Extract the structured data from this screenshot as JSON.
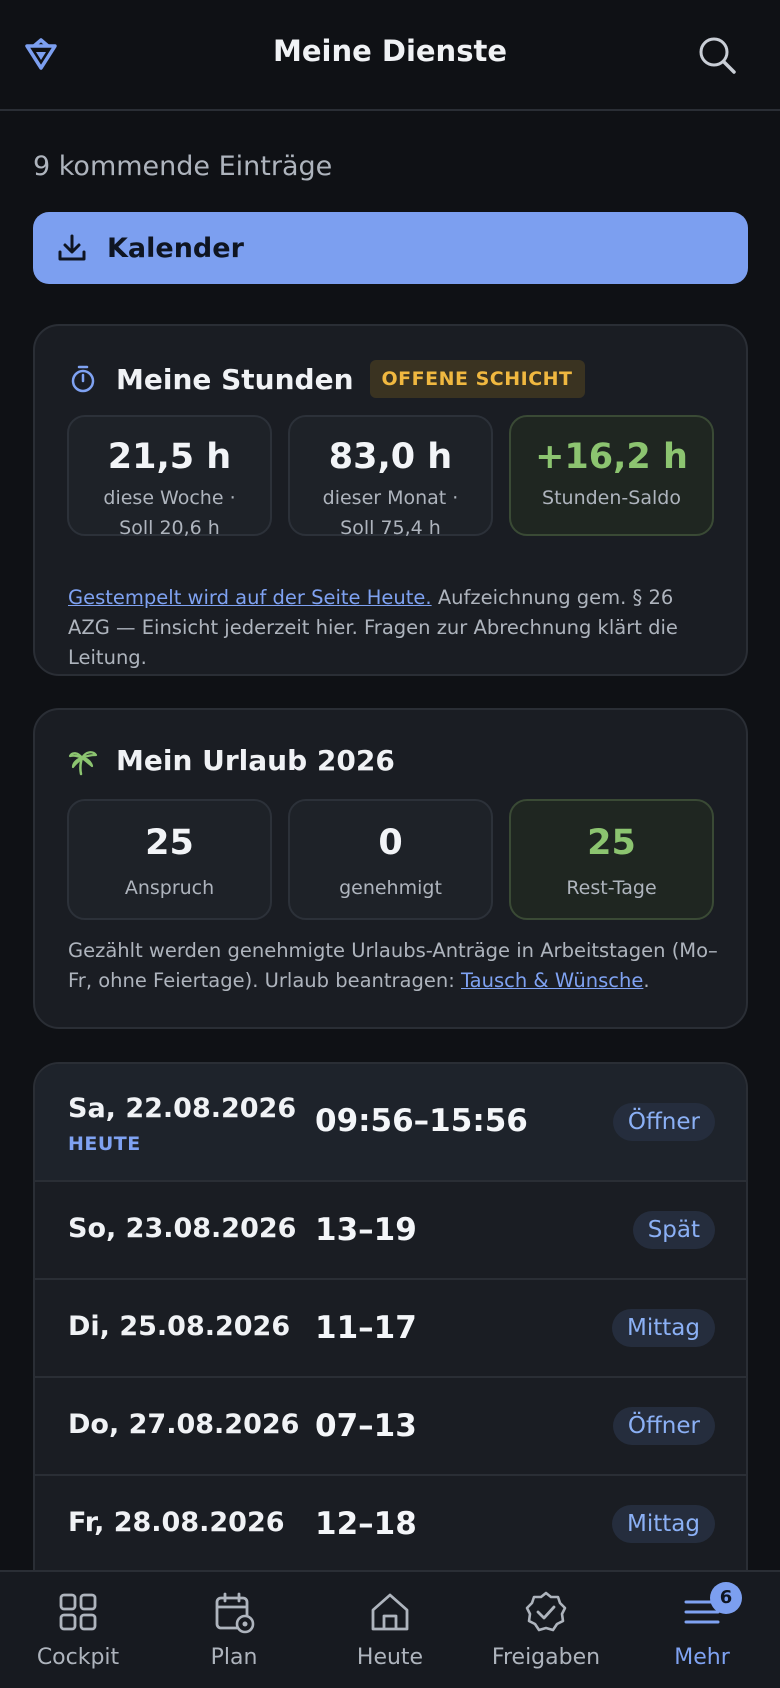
{
  "header": {
    "title": "Meine Dienste",
    "logo_icon": "brand-logo-icon",
    "search_icon": "search-icon"
  },
  "summary": {
    "count_text": "9 kommende Einträge"
  },
  "calendar_button": {
    "label": "Kalender",
    "icon": "download-icon"
  },
  "hours": {
    "title": "Meine Stunden",
    "badge": "OFFENE SCHICHT",
    "stats": [
      {
        "value": "21,5 h",
        "line1": "diese Woche ·",
        "line2": "Soll 20,6 h"
      },
      {
        "value": "83,0 h",
        "line1": "dieser Monat ·",
        "line2": "Soll 75,4 h"
      },
      {
        "value": "+16,2 h",
        "line1": "Stunden-Saldo",
        "line2": ""
      }
    ],
    "note_link": "Gestempelt wird auf der Seite Heute.",
    "note_text": " Aufzeichnung gem. § 26 AZG — Einsicht jederzeit hier. Fragen zur Abrechnung klärt die Leitung."
  },
  "vacation": {
    "title": "Mein Urlaub 2026",
    "stats": [
      {
        "value": "25",
        "label": "Anspruch"
      },
      {
        "value": "0",
        "label": "genehmigt"
      },
      {
        "value": "25",
        "label": "Rest-Tage"
      }
    ],
    "note_text": "Gezählt werden genehmigte Urlaubs-Anträge in Arbeitstagen (Mo–Fr, ohne Feiertage). Urlaub beantragen: ",
    "note_link": "Tausch & Wünsche",
    "note_end": "."
  },
  "shifts": [
    {
      "date": "Sa, 22.08.2026",
      "today": "HEUTE",
      "time": "09:56–15:56",
      "type": "Öffner"
    },
    {
      "date": "So, 23.08.2026",
      "time": "13–19",
      "type": "Spät"
    },
    {
      "date": "Di, 25.08.2026",
      "time": "11–17",
      "type": "Mittag"
    },
    {
      "date": "Do, 27.08.2026",
      "time": "07–13",
      "type": "Öffner"
    },
    {
      "date": "Fr, 28.08.2026",
      "time": "12–18",
      "type": "Mittag"
    }
  ],
  "tabbar": [
    {
      "label": "Cockpit",
      "icon": "grid-icon"
    },
    {
      "label": "Plan",
      "icon": "calendar-settings-icon"
    },
    {
      "label": "Heute",
      "icon": "home-icon"
    },
    {
      "label": "Freigaben",
      "icon": "check-badge-icon"
    },
    {
      "label": "Mehr",
      "icon": "menu-icon",
      "badge": "6",
      "active": true
    }
  ],
  "colors": {
    "accent": "#7c9ff0",
    "positive": "#8cc470",
    "warning": "#f0b840",
    "background": "#0f1115"
  }
}
